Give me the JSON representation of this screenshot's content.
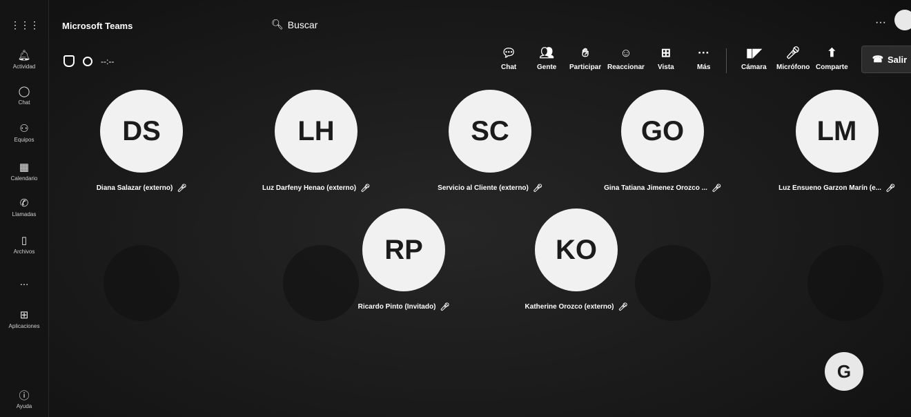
{
  "app": {
    "name": "Microsoft Teams"
  },
  "search": {
    "label": "Buscar"
  },
  "rail": {
    "items": [
      {
        "label": "Actividad",
        "icon": "bell-icon"
      },
      {
        "label": "Chat",
        "icon": "chat-icon"
      },
      {
        "label": "Equipos",
        "icon": "teams-icon"
      },
      {
        "label": "Calendario",
        "icon": "calendar-icon"
      },
      {
        "label": "Llamadas",
        "icon": "phone-icon"
      },
      {
        "label": "Archivos",
        "icon": "file-icon"
      },
      {
        "label": "...",
        "icon": "more-icon"
      },
      {
        "label": "Aplicaciones",
        "icon": "apps-icon"
      }
    ],
    "help": "Ayuda"
  },
  "meeting": {
    "timer": "--:--"
  },
  "toolbar": {
    "chat": "Chat",
    "people": "Gente",
    "raise": "Participar",
    "react": "Reaccionar",
    "view": "Vista",
    "more": "Más",
    "camera": "Cámara",
    "mic": "Micrófono",
    "share": "Comparte",
    "leave": "Salir"
  },
  "participants": [
    {
      "initials": "DS",
      "name": "Diana Salazar (externo)"
    },
    {
      "initials": "LH",
      "name": "Luz Darfeny Henao (externo)"
    },
    {
      "initials": "SC",
      "name": "Servicio al Cliente (externo)"
    },
    {
      "initials": "GO",
      "name": "Gina Tatiana Jimenez Orozco ..."
    },
    {
      "initials": "LM",
      "name": "Luz Ensueno Garzon Marín (e..."
    },
    {
      "initials": "RP",
      "name": "Ricardo Pinto (Invitado)"
    },
    {
      "initials": "KO",
      "name": "Katherine Orozco (externo)"
    }
  ]
}
